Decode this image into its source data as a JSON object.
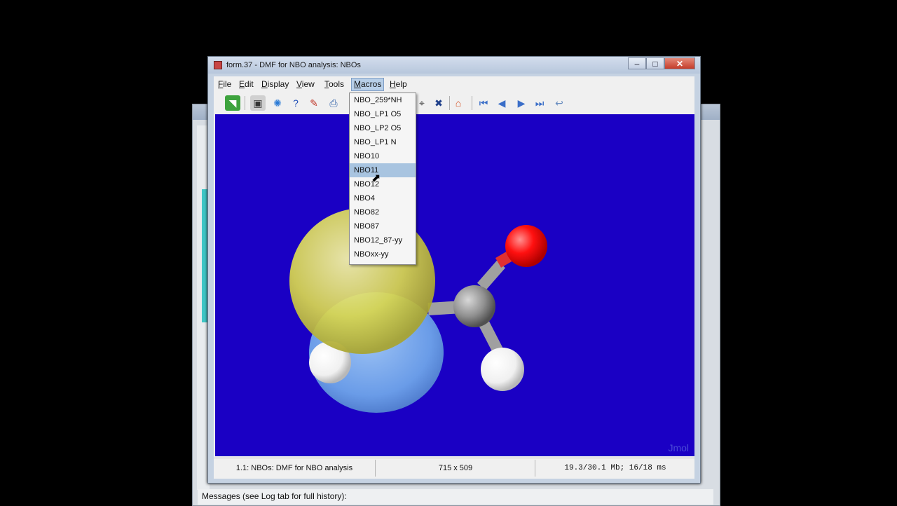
{
  "background_window": {
    "messages_label": "Messages (see Log tab for full history):"
  },
  "window": {
    "title": "form.37 - DMF for NBO analysis: NBOs",
    "minimize_glyph": "–",
    "maximize_glyph": "□",
    "close_glyph": "✕"
  },
  "menubar": {
    "items": [
      {
        "label": "File",
        "mnemonic": "F"
      },
      {
        "label": "Edit",
        "mnemonic": "E"
      },
      {
        "label": "Display",
        "mnemonic": "D"
      },
      {
        "label": "View",
        "mnemonic": "V"
      },
      {
        "label": "Tools",
        "mnemonic": "T"
      },
      {
        "label": "Macros",
        "mnemonic": "M"
      },
      {
        "label": "Help",
        "mnemonic": "H"
      }
    ]
  },
  "toolbar": {
    "icons": [
      "open-icon",
      "screenshot-icon",
      "spin-icon",
      "help-icon",
      "script-editor-icon",
      "print-icon",
      "measure-icon",
      "tools-icon",
      "home-icon",
      "first-frame-icon",
      "prev-frame-icon",
      "next-frame-icon",
      "last-frame-icon",
      "rewind-icon"
    ]
  },
  "macros_menu": {
    "items": [
      "NBO_259*NH",
      "NBO_LP1 O5",
      "NBO_LP2 O5",
      "NBO_LP1 N",
      "NBO10",
      "NBO11",
      "NBO12",
      "NBO4",
      "NBO82",
      "NBO87",
      "NBO12_87-yy",
      "NBOxx-yy"
    ],
    "highlighted": "NBO11"
  },
  "viewer": {
    "background_color": "#1a00c4",
    "watermark": "Jmol"
  },
  "statusbar": {
    "model": "1.1: NBOs: DMF for NBO analysis",
    "size": "715 x 509",
    "memory": "19.3/30.1 Mb;  16/18 ms"
  },
  "colors": {
    "orbital_yellow": "#e8e65a",
    "orbital_blue": "#6a9ce8",
    "oxygen_red": "#ff1010",
    "carbon_gray": "#909090",
    "hydrogen_white": "#ffffff"
  }
}
